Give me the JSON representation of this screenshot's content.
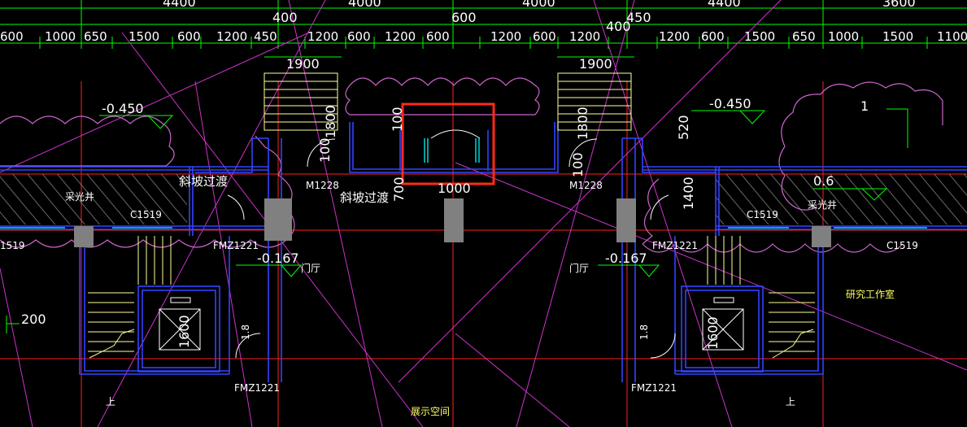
{
  "colors": {
    "background": "#000000",
    "dimension_line": "#00ff00",
    "wall": "#3344ff",
    "axis": "#ff2020",
    "diagonal": "#cc33cc",
    "cloud": "#cc66cc",
    "highlight": "#ff2a1a",
    "stair": "#ffff99",
    "column": "#808080",
    "hatch": "#9a9a9a",
    "window": "#00e5e5"
  },
  "top_dimensions": {
    "row1": [
      "4400",
      "4000",
      "4000",
      "4400",
      "3600"
    ],
    "row2": [
      "400",
      "600",
      "450",
      "400"
    ],
    "row3": [
      "600",
      "1000",
      "650",
      "1500",
      "600",
      "1200",
      "450",
      "1200",
      "600",
      "1200",
      "600",
      "1200",
      "600",
      "1200",
      "1200",
      "600",
      "1500",
      "650",
      "1000",
      "1500",
      "1100"
    ]
  },
  "dims": {
    "left_1900": "1900",
    "right_1900": "1900",
    "d1800_left": "1800",
    "d1800_right": "1800",
    "d100_left": "100",
    "d100_right": "100",
    "d100_center": "100",
    "d520": "520",
    "d700": "700",
    "d1000": "1000",
    "d1400": "1400",
    "d1600_left": "1600",
    "d1600_right": "1600",
    "d1_8_left": "1.8",
    "d1_8_right": "1.8",
    "d200": "200"
  },
  "levels": {
    "left_top": "-0.450",
    "right_top": "-0.450",
    "left_mid": "-0.167",
    "right_mid": "-0.167",
    "right_side": "0.6"
  },
  "labels": {
    "ramp_left": "斜坡过渡",
    "ramp_center": "斜坡过渡",
    "door_m1228_left": "M1228",
    "door_m1228_right": "M1228",
    "lightwell_left": "采光井",
    "lightwell_right": "采光井",
    "window_c1519_left": "C1519",
    "window_c1519_right": "C1519",
    "window_c1519_far_left": "1519",
    "window_c1519_far_right": "C1519",
    "fire_door_left_top": "FMZ1221",
    "fire_door_right_top": "FMZ1221",
    "fire_door_left_bottom": "FMZ1221",
    "fire_door_right_bottom": "FMZ1221",
    "hall_left": "门厅",
    "hall_right": "门厅",
    "research_room": "研究工作室",
    "exhibition": "展示空间",
    "up_left": "上",
    "up_right": "上",
    "marker_1": "1"
  }
}
